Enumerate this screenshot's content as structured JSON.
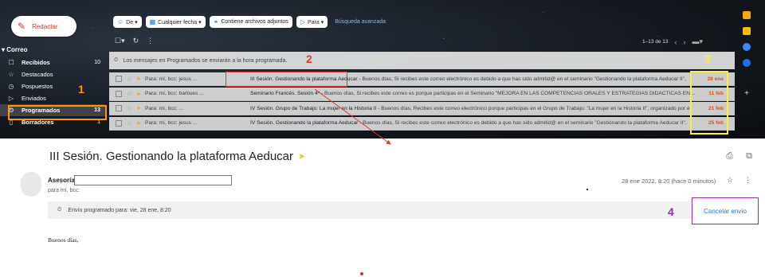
{
  "compose_label": "Redactar",
  "sidebar": {
    "section": "Correo",
    "items": [
      {
        "icon": "☐",
        "icon_name": "inbox-icon",
        "label": "Recibidos",
        "count": "10",
        "bold": true
      },
      {
        "icon": "☆",
        "icon_name": "star-icon",
        "label": "Destacados",
        "count": "",
        "bold": false
      },
      {
        "icon": "◷",
        "icon_name": "clock-icon",
        "label": "Pospuestos",
        "count": "",
        "bold": false
      },
      {
        "icon": "▷",
        "icon_name": "send-icon",
        "label": "Enviados",
        "count": "",
        "bold": false
      },
      {
        "icon": "⏲",
        "icon_name": "scheduled-icon",
        "label": "Programados",
        "count": "13",
        "bold": true
      },
      {
        "icon": "▯",
        "icon_name": "draft-icon",
        "label": "Borradores",
        "count": "1",
        "bold": true
      }
    ]
  },
  "search_chips": [
    {
      "icon": "☺",
      "label": "De ▾"
    },
    {
      "icon": "▦",
      "label": "Cualquier fecha ▾"
    },
    {
      "icon": "⚭",
      "label": "Contiene archivos adjuntos"
    },
    {
      "icon": "▷",
      "label": "Para ▾"
    }
  ],
  "advanced_search": "Búsqueda avanzada",
  "pager": {
    "range": "1–13 de 13"
  },
  "banner_text": "Los mensajes en Programados se enviarán a la hora programada.",
  "rows": [
    {
      "from": "Para: mí, bcc: jesus ...",
      "subject": "III Sesión. Gestionando la plataforma Aeducar",
      "snippet": " - Buenos días, Si recibes este correo electrónico es debido a que has sido admitid@ en el seminario \"Gestionando la plataforma Aeducar II\",",
      "date": "28 ene"
    },
    {
      "from": "Para: mí, bcc: barbues ...",
      "subject": "Seminario Francés. Sesión 4ª",
      "snippet": " - Buenos días, Si recibes este correo es porque participas en el Seminario \"MEJORA EN LAS COMPETENCIAS ORALES Y ESTRATÉGIAS DIDÁCTICAS EN FRA",
      "date": "11 feb"
    },
    {
      "from": "Para: mí, bcc: ...",
      "subject": "IV Sesión. Grupo de Trabajo: La mujer en la Historia II",
      "snippet": " - Buenos días, Recibes este correo electrónico porque participas en el Grupo de Trabajo: \"La mujer en la Historia II\", organizado por e",
      "date": "21 feb"
    },
    {
      "from": "Para: mí, bcc: jesus ...",
      "subject": "IV Sesión. Gestionando la plataforma Aeducar",
      "snippet": " - Buenos días, Si recibes este correo electrónico es debido a que has sido admitid@ en el seminario \"Gestionando la plataforma Aeducar II\",",
      "date": "25 feb"
    }
  ],
  "annotations": [
    "1",
    "2",
    "3",
    "4"
  ],
  "annotation_colors": {
    "orange": "#ff9800",
    "red": "#e53935",
    "yellow": "#ffeb3b",
    "purple": "#9c27b0"
  },
  "message": {
    "title": "III Sesión. Gestionando la plataforma Aeducar",
    "sender": "Asesoría",
    "to": "para mí, bcc:",
    "datetime": "28 ene 2022, 8:20 (hace 0 minutos)",
    "scheduled": "Envío programado para: vie, 28 ene, 8:20",
    "cancel_label": "Cancelar envío",
    "greeting": "Buenos días,"
  }
}
